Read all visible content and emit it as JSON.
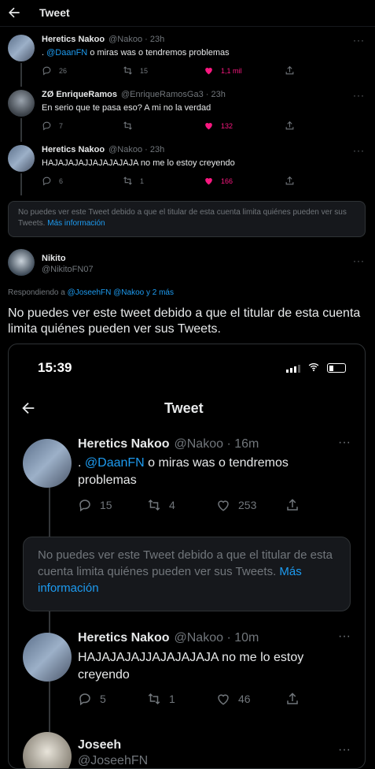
{
  "header": {
    "title": "Tweet"
  },
  "tweets": [
    {
      "name": "Heretics Nakoo",
      "handle": "@Nakoo · 23h",
      "pre": ". ",
      "mention": "@DaanFN",
      "text": " o miras was o tendremos problemas",
      "replies": "26",
      "retweets": "15",
      "likes": "1,1 mil"
    },
    {
      "name": "ZØ EnriqueRamos",
      "handle": "@EnriqueRamosGa3 · 23h",
      "text": "En serio que te pasa eso? A mi no la verdad",
      "replies": "7",
      "retweets": "",
      "likes": "132"
    },
    {
      "name": "Heretics Nakoo",
      "handle": "@Nakoo · 23h",
      "text": "HAJAJAJAJJAJAJAJAJA no me lo estoy creyendo",
      "replies": "6",
      "retweets": "1",
      "likes": "166"
    }
  ],
  "notice": {
    "text": "No puedes ver este Tweet debido a que el titular de esta cuenta limita quiénes pueden ver sus Tweets.",
    "link": "Más información"
  },
  "main": {
    "name": "Nikito",
    "handle": "@NikitoFN07",
    "replying_prefix": "Respondiendo a ",
    "replying_to": "@JoseehFN @Nakoo y 2 más",
    "text": "No puedes ver este tweet debido a que el titular de esta cuenta limita quiénes pueden ver sus Tweets."
  },
  "phone": {
    "time": "15:39",
    "title": "Tweet",
    "tweet1": {
      "name": "Heretics Nakoo",
      "handle": "@Nakoo · 16m",
      "pre": ". ",
      "mention": "@DaanFN",
      "text_line1": " o miras was o tendremos",
      "text_line2": "problemas",
      "replies": "15",
      "retweets": "4",
      "likes": "253"
    },
    "notice": {
      "text": "No puedes ver este Tweet debido a que el titular de esta cuenta limita quiénes pueden ver sus Tweets.",
      "link": "Más información"
    },
    "tweet2": {
      "name": "Heretics Nakoo",
      "handle": "@Nakoo · 10m",
      "text_line1": "HAJAJAJAJJAJAJAJAJA no me lo estoy",
      "text_line2": "creyendo",
      "replies": "5",
      "retweets": "1",
      "likes": "46"
    },
    "tweet3": {
      "name": "Joseeh",
      "handle": "@JoseehFN"
    }
  },
  "colors": {
    "accent": "#1d9bf0",
    "like": "#f91880",
    "muted": "#71767b",
    "background": "#000000"
  }
}
